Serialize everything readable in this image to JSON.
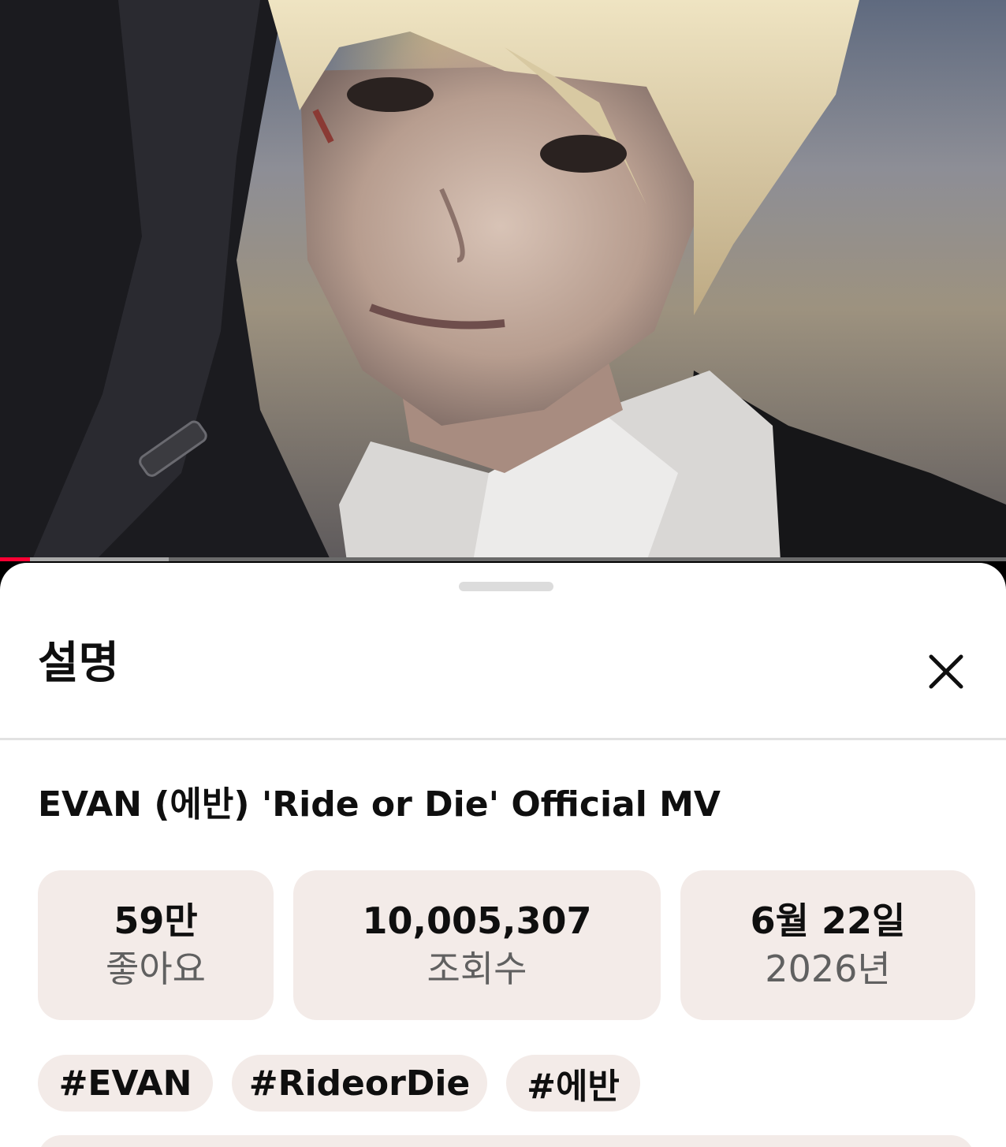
{
  "player": {
    "progress_played": 0.03,
    "progress_buffered": 0.168,
    "accent_color": "#ff0033"
  },
  "sheet": {
    "title": "설명",
    "close_icon": "close-icon"
  },
  "video": {
    "title": "EVAN (에반) 'Ride or Die' Official MV"
  },
  "stats": [
    {
      "value": "59만",
      "label": "좋아요"
    },
    {
      "value": "10,005,307",
      "label": "조회수"
    },
    {
      "value": "6월 22일",
      "label": "2026년"
    }
  ],
  "tags": [
    "#EVAN",
    "#RideorDie",
    "#에반"
  ],
  "colors": {
    "chip_background": "#f3ebe8",
    "text_primary": "#0f0f0f",
    "text_secondary": "#606060"
  }
}
